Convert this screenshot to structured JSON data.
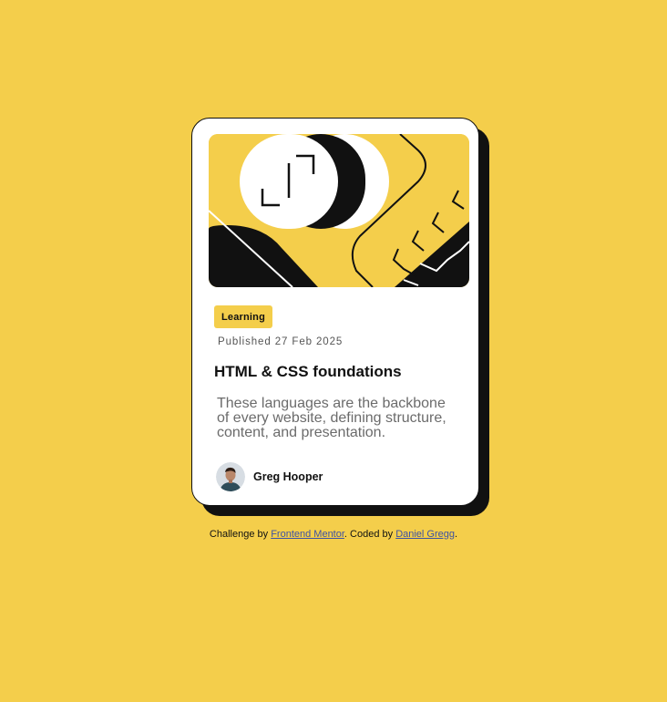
{
  "card": {
    "image_alt": "abstract illustration",
    "tag": "Learning",
    "published": "Published 27 Feb 2025",
    "title": "HTML & CSS foundations",
    "description": "These languages are the backbone of every website, defining structure, content, and presentation.",
    "author": {
      "name": "Greg Hooper"
    }
  },
  "attribution": {
    "prefix": "Challenge by ",
    "link1": "Frontend Mentor",
    "middle": ". Coded by ",
    "link2": "Daniel Gregg",
    "suffix": "."
  },
  "colors": {
    "background": "#f4ce4b",
    "card": "#ffffff",
    "ink": "#111111",
    "muted": "#6b6b6b",
    "link": "#3e52a3"
  }
}
